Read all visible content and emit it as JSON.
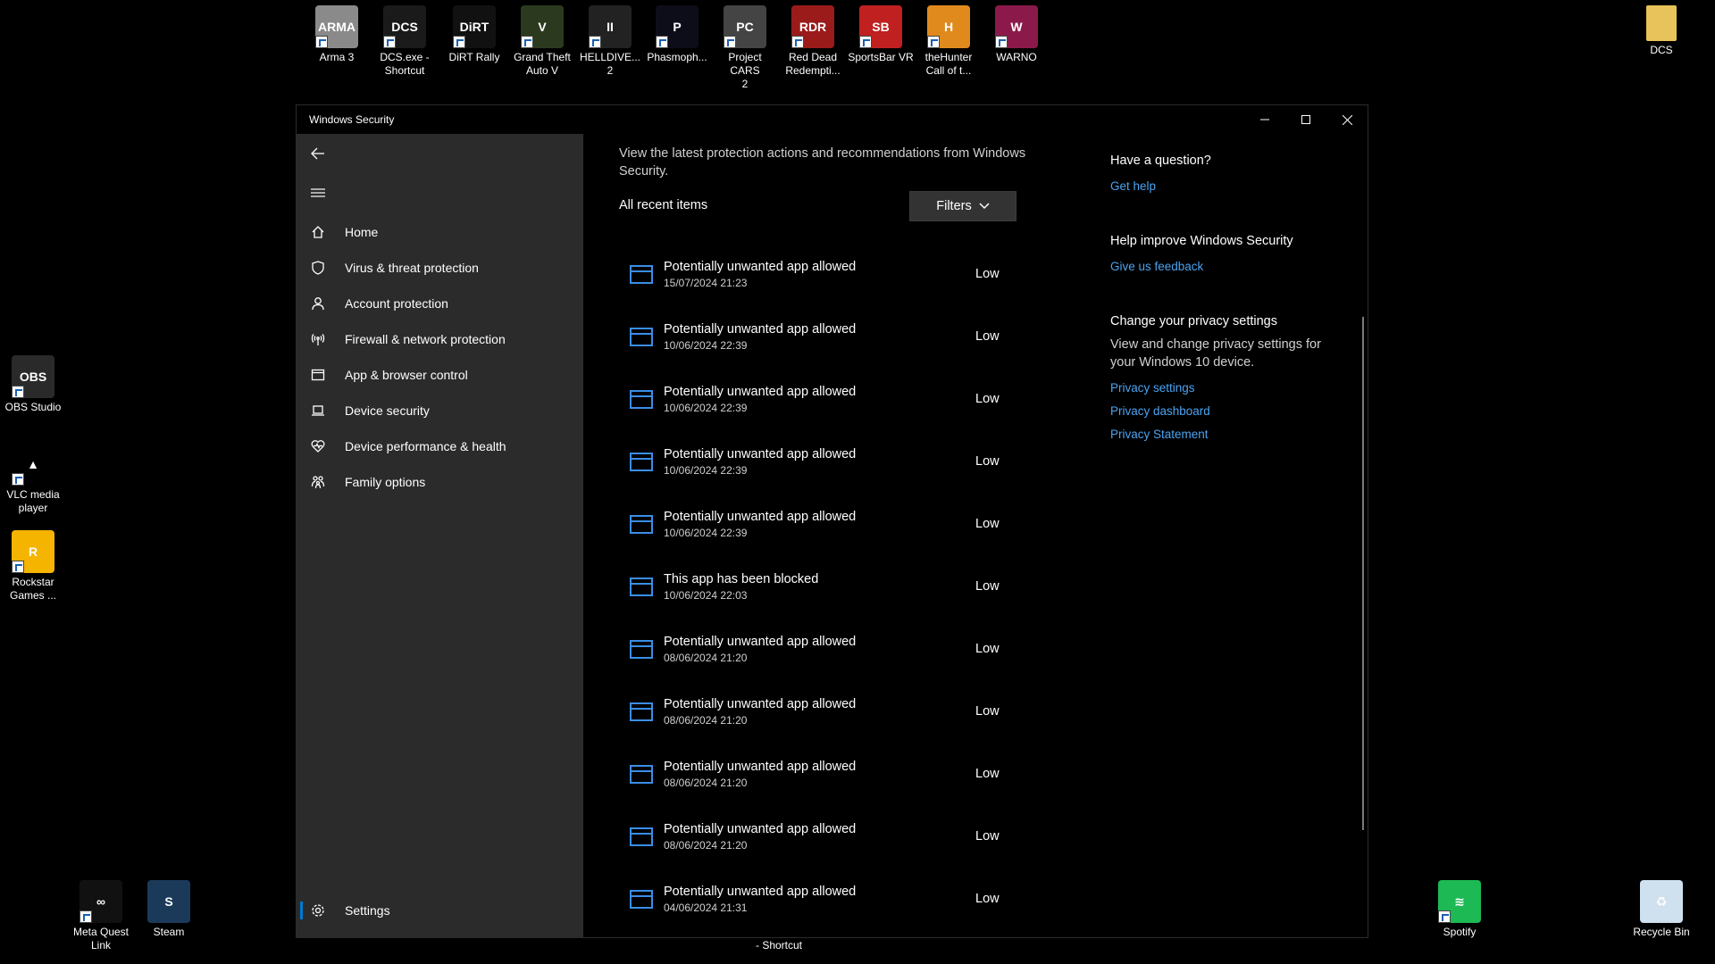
{
  "desktop_icons": [
    {
      "label": "Arma 3",
      "icon": "arma3-icon",
      "color": "#8a8a8a",
      "glyph": "ARMA",
      "shortcut": true
    },
    {
      "label": "DCS.exe -\nShortcut",
      "icon": "dcs-icon",
      "color": "#1a1a1a",
      "glyph": "DCS",
      "shortcut": true
    },
    {
      "label": "DiRT Rally",
      "icon": "dirt-rally-icon",
      "color": "#111111",
      "glyph": "DiRT",
      "shortcut": true
    },
    {
      "label": "Grand Theft\nAuto V",
      "icon": "gta-v-icon",
      "color": "#2b3a1e",
      "glyph": "V",
      "shortcut": true
    },
    {
      "label": "HELLDIVE...\n2",
      "icon": "helldivers-icon",
      "color": "#222222",
      "glyph": "II",
      "shortcut": true
    },
    {
      "label": "Phasmoph...",
      "icon": "phasmophobia-icon",
      "color": "#0d0d1a",
      "glyph": "P",
      "shortcut": true
    },
    {
      "label": "Project CARS\n2",
      "icon": "project-cars-icon",
      "color": "#444444",
      "glyph": "PC",
      "shortcut": true
    },
    {
      "label": "Red Dead\nRedempti...",
      "icon": "red-dead-icon",
      "color": "#9b1b1b",
      "glyph": "RDR",
      "shortcut": true
    },
    {
      "label": "SportsBar VR",
      "icon": "sportsbar-vr-icon",
      "color": "#c02020",
      "glyph": "SB",
      "shortcut": true
    },
    {
      "label": "theHunter\nCall of t...",
      "icon": "thehunter-icon",
      "color": "#e08a1e",
      "glyph": "H",
      "shortcut": true
    },
    {
      "label": "WARNO",
      "icon": "warno-icon",
      "color": "#8b1a4a",
      "glyph": "W",
      "shortcut": true
    },
    {
      "label": "DCS",
      "icon": "folder-icon",
      "color": "#e8c25a",
      "glyph": "",
      "shortcut": false
    },
    {
      "label": "OBS Studio",
      "icon": "obs-studio-icon",
      "color": "#2a2a2a",
      "glyph": "OBS",
      "shortcut": true
    },
    {
      "label": "VLC media\nplayer",
      "icon": "vlc-icon",
      "color": "#000000",
      "glyph": "▲",
      "shortcut": true
    },
    {
      "label": "Rockstar\nGames ...",
      "icon": "rockstar-games-icon",
      "color": "#f4b400",
      "glyph": "R",
      "shortcut": true
    },
    {
      "label": "Meta Quest\nLink",
      "icon": "meta-quest-icon",
      "color": "#111111",
      "glyph": "∞",
      "shortcut": true
    },
    {
      "label": "Steam",
      "icon": "steam-icon",
      "color": "#1b3a5a",
      "glyph": "S",
      "shortcut": false
    },
    {
      "label": "Spotify",
      "icon": "spotify-icon",
      "color": "#1db954",
      "glyph": "≋",
      "shortcut": true
    },
    {
      "label": "Recycle Bin",
      "icon": "recycle-bin-icon",
      "color": "#cfe0ef",
      "glyph": "♻",
      "shortcut": false
    }
  ],
  "window": {
    "title": "Windows Security",
    "minimize_icon": "minimize-icon",
    "maximize_icon": "maximize-icon",
    "close_icon": "close-icon"
  },
  "sidebar": {
    "items": [
      {
        "label": "Home",
        "icon": "home-icon"
      },
      {
        "label": "Virus & threat protection",
        "icon": "shield-icon"
      },
      {
        "label": "Account protection",
        "icon": "person-icon"
      },
      {
        "label": "Firewall & network protection",
        "icon": "antenna-icon"
      },
      {
        "label": "App & browser control",
        "icon": "app-window-icon"
      },
      {
        "label": "Device security",
        "icon": "laptop-icon"
      },
      {
        "label": "Device performance & health",
        "icon": "heart-icon"
      },
      {
        "label": "Family options",
        "icon": "family-icon"
      }
    ],
    "settings_label": "Settings"
  },
  "main": {
    "intro": "View the latest protection actions and recommendations from Windows Security.",
    "recent_label": "All recent items",
    "filters_label": "Filters",
    "items": [
      {
        "title": "Potentially unwanted app allowed",
        "date": "15/07/2024 21:23",
        "severity": "Low"
      },
      {
        "title": "Potentially unwanted app allowed",
        "date": "10/06/2024 22:39",
        "severity": "Low"
      },
      {
        "title": "Potentially unwanted app allowed",
        "date": "10/06/2024 22:39",
        "severity": "Low"
      },
      {
        "title": "Potentially unwanted app allowed",
        "date": "10/06/2024 22:39",
        "severity": "Low"
      },
      {
        "title": "Potentially unwanted app allowed",
        "date": "10/06/2024 22:39",
        "severity": "Low"
      },
      {
        "title": "This app has been blocked",
        "date": "10/06/2024 22:03",
        "severity": "Low"
      },
      {
        "title": "Potentially unwanted app allowed",
        "date": "08/06/2024 21:20",
        "severity": "Low"
      },
      {
        "title": "Potentially unwanted app allowed",
        "date": "08/06/2024 21:20",
        "severity": "Low"
      },
      {
        "title": "Potentially unwanted app allowed",
        "date": "08/06/2024 21:20",
        "severity": "Low"
      },
      {
        "title": "Potentially unwanted app allowed",
        "date": "08/06/2024 21:20",
        "severity": "Low"
      },
      {
        "title": "Potentially unwanted app allowed",
        "date": "04/06/2024 21:31",
        "severity": "Low"
      }
    ]
  },
  "right_panel": {
    "question_heading": "Have a question?",
    "get_help": "Get help",
    "improve_heading": "Help improve Windows Security",
    "feedback": "Give us feedback",
    "privacy_heading": "Change your privacy settings",
    "privacy_text": "View and change privacy settings for your Windows 10 device.",
    "privacy_settings": "Privacy settings",
    "privacy_dashboard": "Privacy dashboard",
    "privacy_statement": "Privacy Statement"
  },
  "background_text": "- Shortcut",
  "colors": {
    "sidebar_bg": "#2b2b2b",
    "accent": "#0078d4",
    "link": "#4aa3f0",
    "item_icon": "#3a8ee6"
  }
}
